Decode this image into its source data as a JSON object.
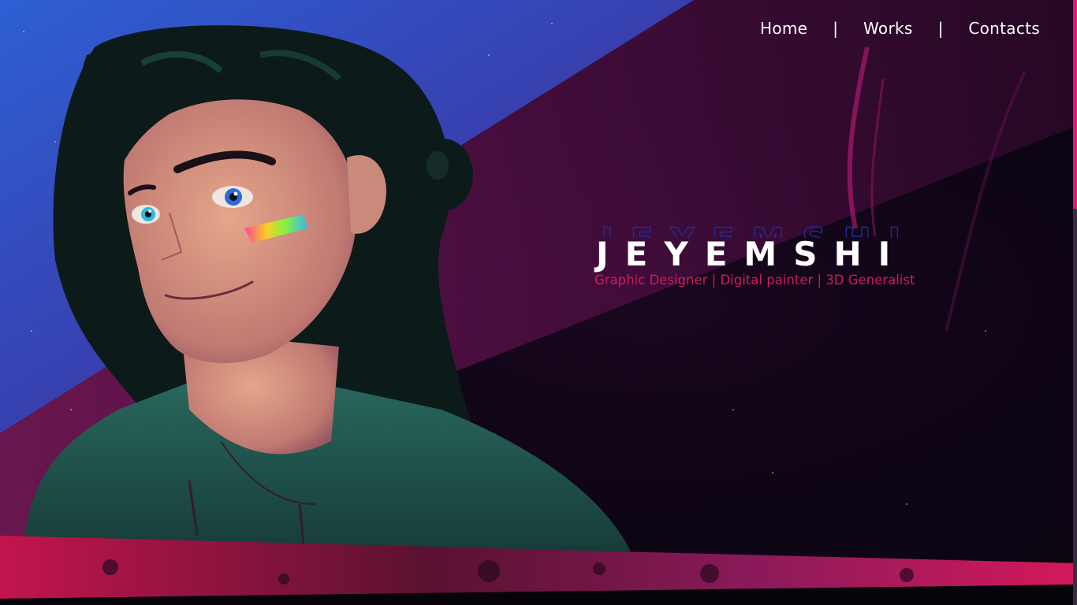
{
  "nav": {
    "items": [
      {
        "label": "Home"
      },
      {
        "label": "Works"
      },
      {
        "label": "Contacts"
      }
    ],
    "separator": "|"
  },
  "hero": {
    "name": "JEYEMSHI",
    "subtitle": "Graphic Designer | Digital painter | 3D Generalist"
  },
  "colors": {
    "accent_pink": "#d4195a",
    "scroll_indicator": "#e01a78",
    "sky_blue": "#2f54c8",
    "hoodie_green": "#1f5a52"
  },
  "illustration": {
    "subject": "portrait-illustration",
    "icon": "character-portrait"
  }
}
